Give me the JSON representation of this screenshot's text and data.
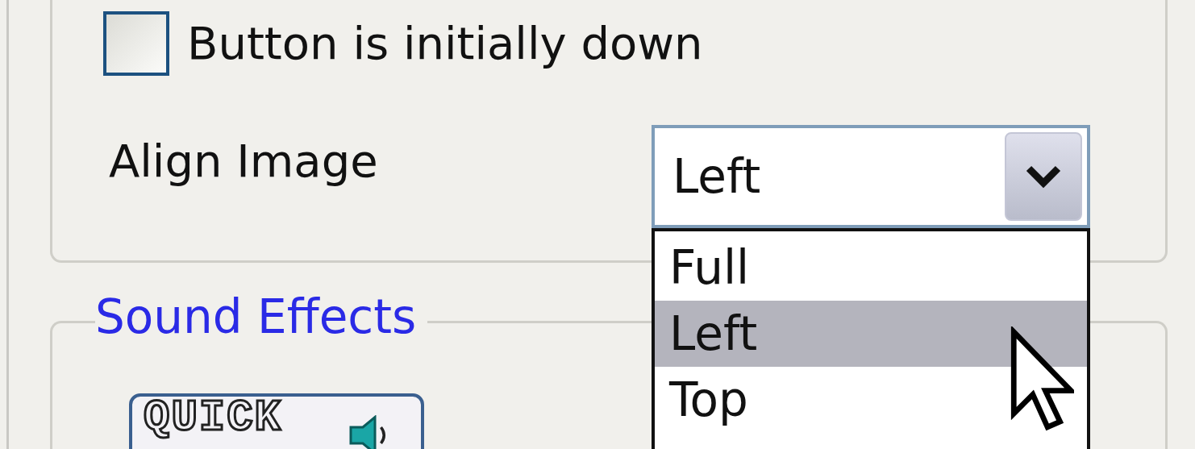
{
  "checkbox": {
    "label": "Button is initially down",
    "checked": false
  },
  "align_image": {
    "label": "Align Image",
    "value": "Left",
    "expanded": true,
    "options": [
      {
        "label": "Full",
        "selected": false
      },
      {
        "label": "Left",
        "selected": true
      },
      {
        "label": "Top",
        "selected": false
      }
    ]
  },
  "sound_effects": {
    "title": "Sound Effects",
    "image_button": {
      "label": "QUICK"
    }
  }
}
